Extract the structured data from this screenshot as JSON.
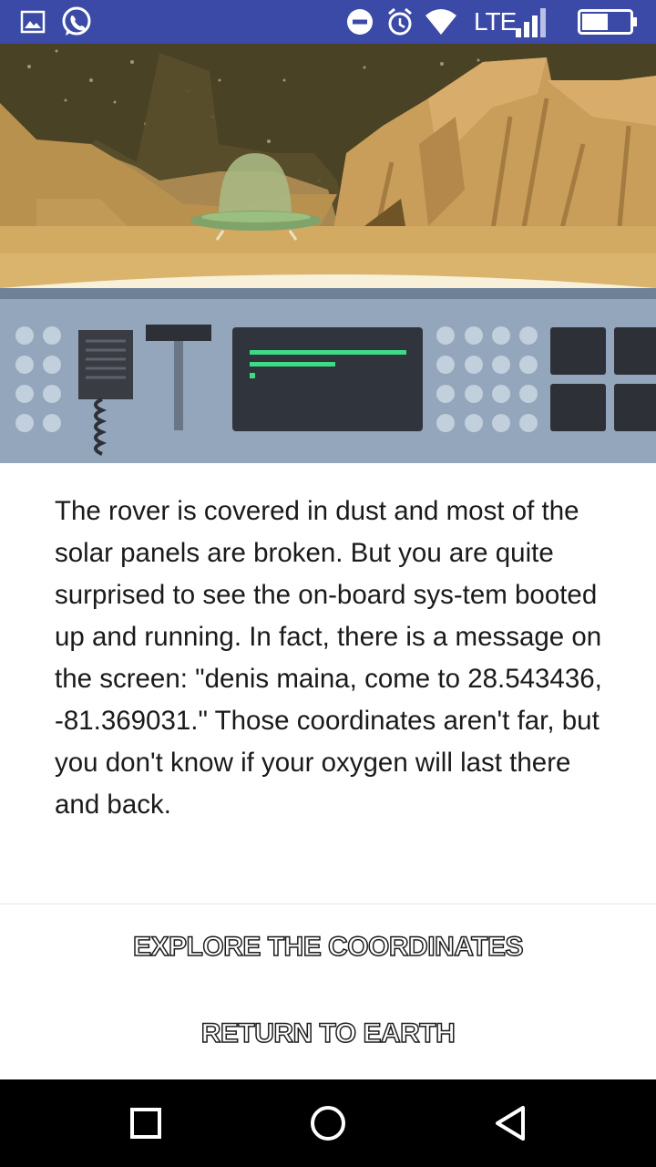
{
  "status_bar": {
    "network_label": "LTE",
    "icons": [
      "gallery-icon",
      "whatsapp-icon",
      "do-not-disturb-icon",
      "alarm-icon",
      "wifi-icon",
      "signal-icon",
      "battery-icon"
    ]
  },
  "scene": {
    "description_icons": [
      "ufo-icon",
      "radio-handset-icon",
      "control-panel-screen"
    ]
  },
  "story": {
    "text": "The rover is covered in dust and most of the solar panels are broken. But you are quite surprised to see the on-board sys-tem booted up and running. In fact, there is a message on the screen: \"denis maina, come to 28.543436, -81.369031.\" Those coordinates aren't far, but you don't know if your oxygen will last there and back."
  },
  "choices": {
    "explore_label": "EXPLORE THE COORDINATES",
    "return_label": "RETURN TO EARTH"
  },
  "nav": {
    "icons": [
      "recents-icon",
      "home-icon",
      "back-icon"
    ]
  },
  "colors": {
    "status_bar": "#3b4aa6",
    "sky": "#4a4225",
    "rock": "#c99d5a",
    "panel": "#93a6bb",
    "screen_text": "#3ddc84"
  }
}
